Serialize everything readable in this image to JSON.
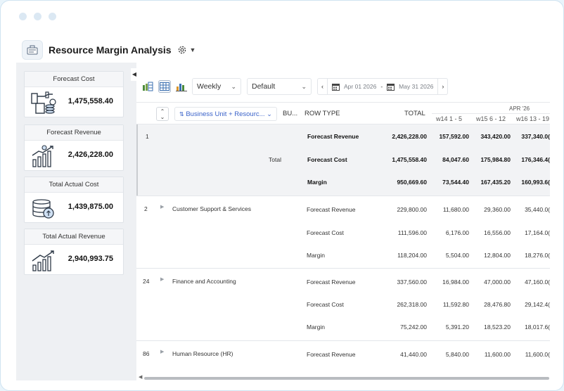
{
  "app": {
    "title": "Resource Margin Analysis"
  },
  "kpis": [
    {
      "title": "Forecast Cost",
      "value": "1,475,558.40",
      "icon": "money-hand-icon"
    },
    {
      "title": "Forecast Revenue",
      "value": "2,426,228.00",
      "icon": "revenue-growth-icon"
    },
    {
      "title": "Total Actual Cost",
      "value": "1,439,875.00",
      "icon": "coin-stack-icon"
    },
    {
      "title": "Total Actual Revenue",
      "value": "2,940,993.75",
      "icon": "bar-growth-icon"
    }
  ],
  "toolbar": {
    "period": "Weekly",
    "view": "Default",
    "date_from": "Apr 01 2026",
    "date_to": "May 31 2026",
    "date_separator": "-"
  },
  "header": {
    "group_chip": "Business Unit + Resourc...",
    "col_bu": "BU...",
    "col_row_type": "ROW TYPE",
    "col_total": "TOTAL",
    "month": "APR '26",
    "weeks": [
      "w14 1 - 5",
      "w15 6 - 12",
      "w16 13 - 19"
    ]
  },
  "groups": [
    {
      "id": "1",
      "name": "",
      "label": "Total",
      "is_total": true,
      "rows": [
        {
          "type": "Forecast Revenue",
          "total": "2,426,228.00",
          "w": [
            "157,592.00",
            "343,420.00",
            "337,340.0("
          ]
        },
        {
          "type": "Forecast Cost",
          "total": "1,475,558.40",
          "w": [
            "84,047.60",
            "175,984.80",
            "176,346.4("
          ]
        },
        {
          "type": "Margin",
          "total": "950,669.60",
          "w": [
            "73,544.40",
            "167,435.20",
            "160,993.6("
          ]
        }
      ]
    },
    {
      "id": "2",
      "name": "Customer Support & Services",
      "label": "",
      "is_total": false,
      "rows": [
        {
          "type": "Forecast Revenue",
          "total": "229,800.00",
          "w": [
            "11,680.00",
            "29,360.00",
            "35,440.0("
          ]
        },
        {
          "type": "Forecast Cost",
          "total": "111,596.00",
          "w": [
            "6,176.00",
            "16,556.00",
            "17,164.0("
          ]
        },
        {
          "type": "Margin",
          "total": "118,204.00",
          "w": [
            "5,504.00",
            "12,804.00",
            "18,276.0("
          ]
        }
      ]
    },
    {
      "id": "24",
      "name": "Finance and Accounting",
      "label": "",
      "is_total": false,
      "rows": [
        {
          "type": "Forecast Revenue",
          "total": "337,560.00",
          "w": [
            "16,984.00",
            "47,000.00",
            "47,160.0("
          ]
        },
        {
          "type": "Forecast Cost",
          "total": "262,318.00",
          "w": [
            "11,592.80",
            "28,476.80",
            "29,142.4("
          ]
        },
        {
          "type": "Margin",
          "total": "75,242.00",
          "w": [
            "5,391.20",
            "18,523.20",
            "18,017.6("
          ]
        }
      ]
    },
    {
      "id": "86",
      "name": "Human Resource (HR)",
      "label": "",
      "is_total": false,
      "rows": [
        {
          "type": "Forecast Revenue",
          "total": "41,440.00",
          "w": [
            "5,840.00",
            "11,600.00",
            "11,600.0("
          ]
        }
      ]
    }
  ]
}
